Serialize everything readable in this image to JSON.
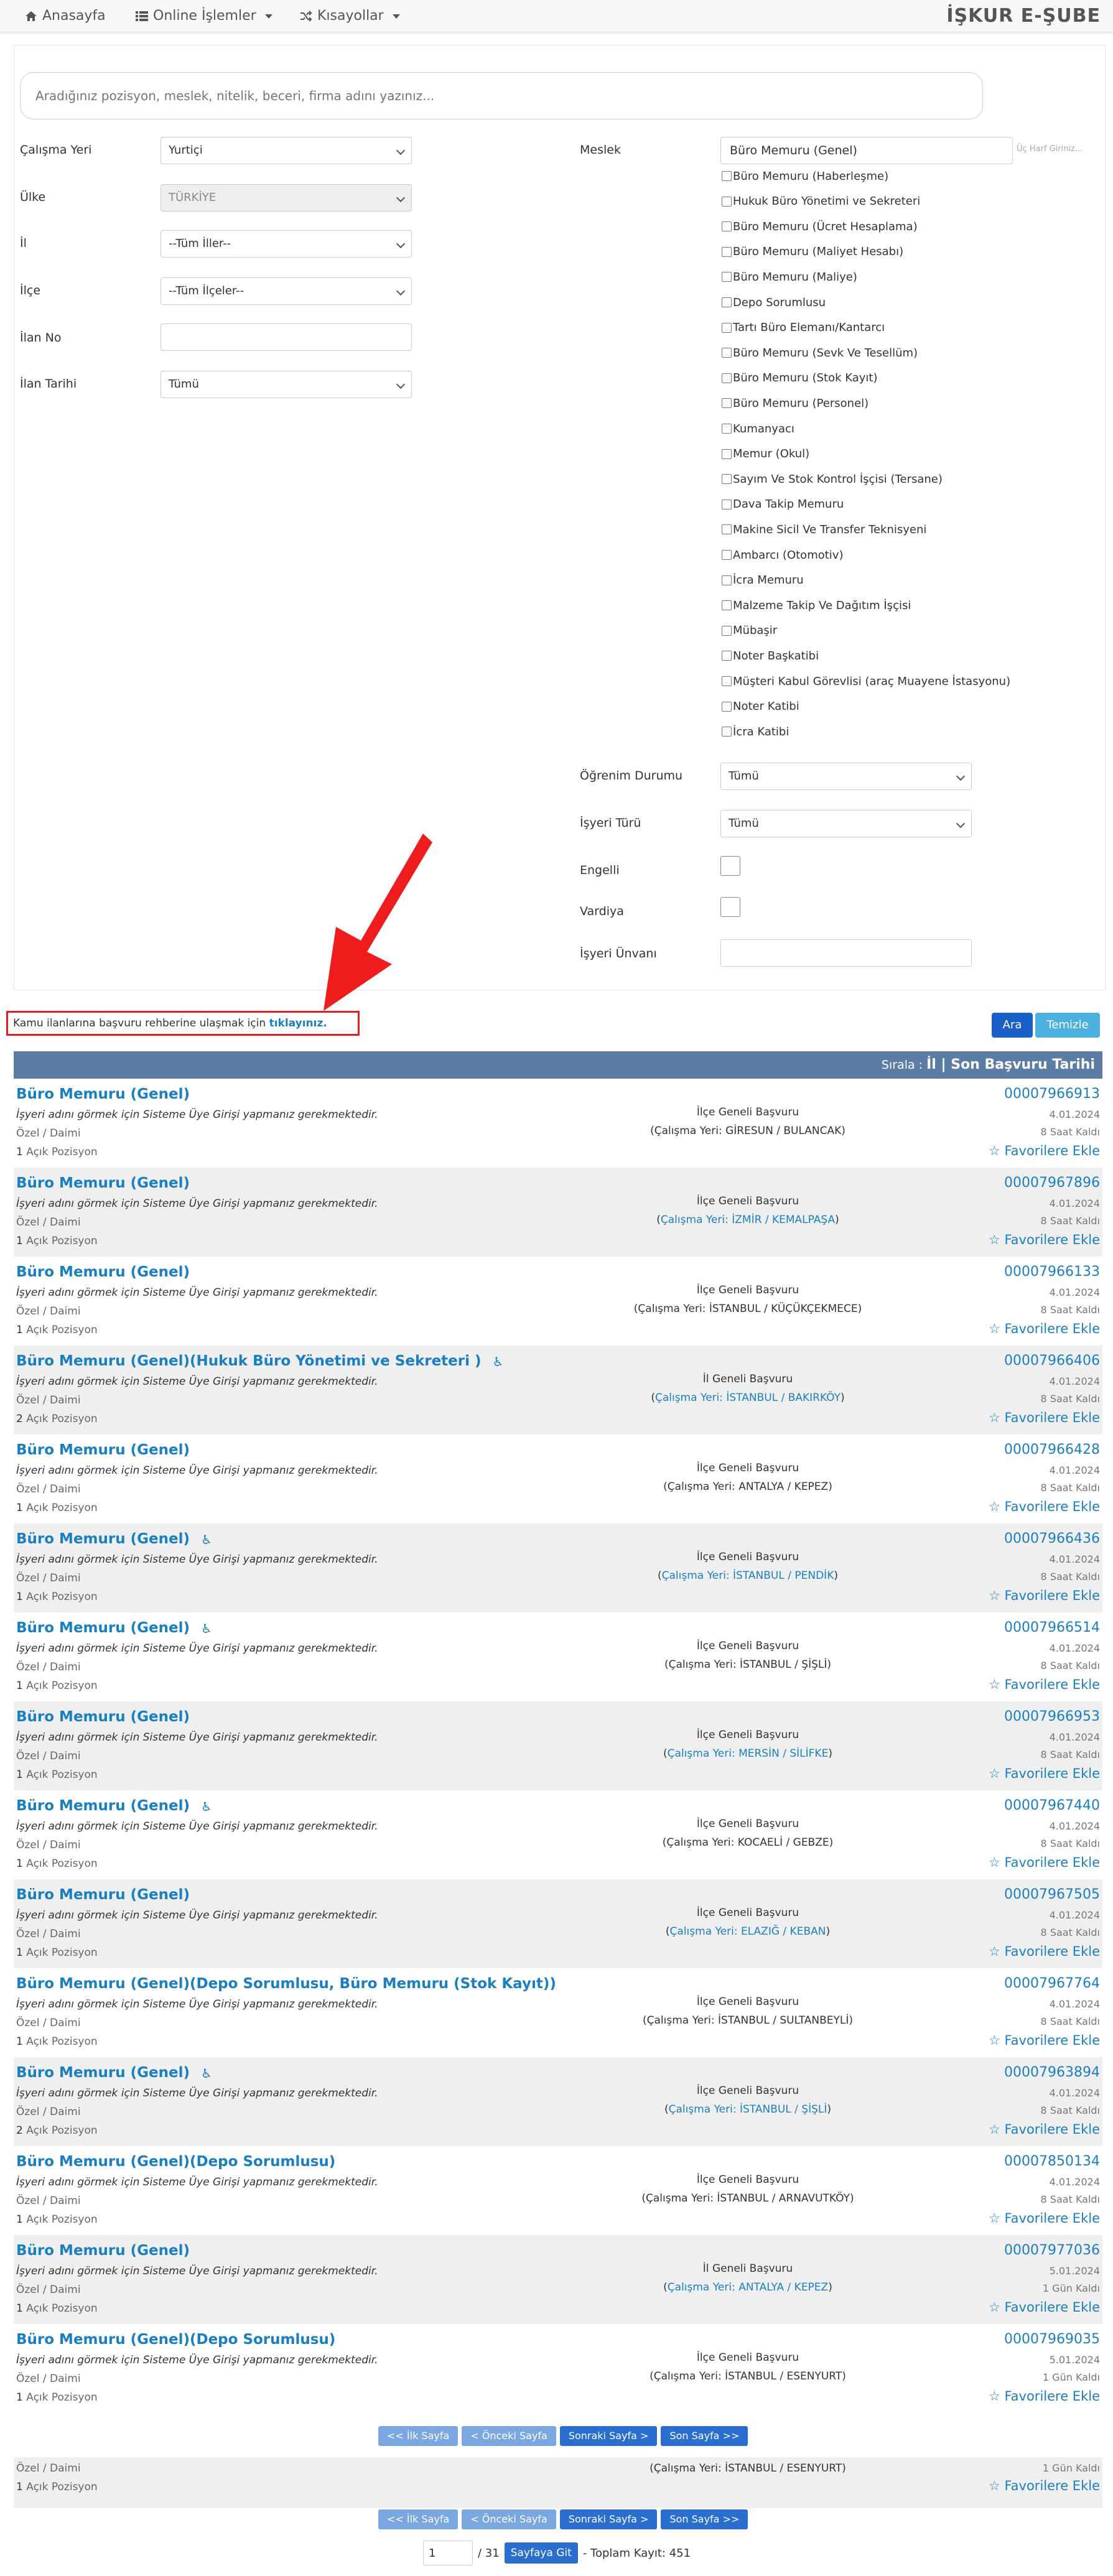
{
  "nav": {
    "home": "Anasayfa",
    "online": "Online İşlemler",
    "shortcuts": "Kısayollar",
    "brand": "İŞKUR E-ŞUBE"
  },
  "search": {
    "placeholder": "Aradığınız pozisyon, meslek, nitelik, beceri, firma adını yazınız..."
  },
  "filters": {
    "calisma_yeri_label": "Çalışma Yeri",
    "calisma_yeri_value": "Yurtiçi",
    "ulke_label": "Ülke",
    "ulke_value": "TÜRKİYE",
    "il_label": "İl",
    "il_value": "--Tüm İller--",
    "ilce_label": "İlçe",
    "ilce_value": "--Tüm İlçeler--",
    "ilan_no_label": "İlan No",
    "ilan_tarihi_label": "İlan Tarihi",
    "ilan_tarihi_value": "Tümü",
    "meslek_label": "Meslek",
    "meslek_value": "Büro Memuru (Genel)",
    "meslek_hint": "Üç Harf Giriniz...",
    "ogrenim_label": "Öğrenim Durumu",
    "ogrenim_value": "Tümü",
    "isyeri_turu_label": "İşyeri Türü",
    "isyeri_turu_value": "Tümü",
    "engelli_label": "Engelli",
    "vardiya_label": "Vardiya",
    "isyeri_unvani_label": "İşyeri Ünvanı"
  },
  "meslek_options": [
    "Büro Memuru (Haberleşme)",
    "Hukuk Büro Yönetimi ve Sekreteri",
    "Büro Memuru (Ücret Hesaplama)",
    "Büro Memuru (Maliyet Hesabı)",
    "Büro Memuru (Maliye)",
    "Depo Sorumlusu",
    "Tartı Büro Elemanı/Kantarcı",
    "Büro Memuru (Sevk Ve Tesellüm)",
    "Büro Memuru (Stok Kayıt)",
    "Büro Memuru (Personel)",
    "Kumanyacı",
    "Memur (Okul)",
    "Sayım Ve Stok Kontrol İşçisi (Tersane)",
    "Dava Takip Memuru",
    "Makine Sicil Ve Transfer Teknisyeni",
    "Ambarcı (Otomotiv)",
    "İcra Memuru",
    "Malzeme Takip Ve Dağıtım İşçisi",
    "Mübaşir",
    "Noter Başkatibi",
    "Müşteri Kabul Görevlisi (araç Muayene İstasyonu)",
    "Noter Katibi",
    "İcra Katibi"
  ],
  "announcement": {
    "text": "Kamu ilanlarına başvuru rehberine ulaşmak için ",
    "link": "tıklayınız."
  },
  "buttons": {
    "ara": "Ara",
    "temizle": "Temizle"
  },
  "sort": {
    "label": "Sırala : ",
    "il": "İl",
    "sep": " | ",
    "date": "Son Başvuru Tarihi"
  },
  "results": [
    {
      "title": "Büro Memuru (Genel)",
      "acc": false,
      "note": "İşyeri adını görmek için Sisteme Üye Girişi yapmanız gerekmektedir.",
      "type": "Özel / Daimi",
      "count": "1",
      "pos": "Açık Pozisyon",
      "app": "İlçe Geneli Başvuru",
      "loc_pre": "(",
      "loc_lbl": "Çalışma Yeri: ",
      "loc": "GİRESUN / BULANCAK",
      "loc_post": ")",
      "loc_blue": false,
      "no": "00007966913",
      "date": "4.01.2024",
      "left": "8 Saat Kaldı",
      "fav": "Favorilere Ekle"
    },
    {
      "title": "Büro Memuru (Genel)",
      "acc": false,
      "note": "İşyeri adını görmek için Sisteme Üye Girişi yapmanız gerekmektedir.",
      "type": "Özel / Daimi",
      "count": "1",
      "pos": "Açık Pozisyon",
      "app": "İlçe Geneli Başvuru",
      "loc_pre": "(",
      "loc_lbl": "Çalışma Yeri: ",
      "loc": "İZMİR / KEMALPAŞA",
      "loc_post": ")",
      "loc_blue": true,
      "no": "00007967896",
      "date": "4.01.2024",
      "left": "8 Saat Kaldı",
      "fav": "Favorilere Ekle"
    },
    {
      "title": "Büro Memuru (Genel)",
      "acc": false,
      "note": "İşyeri adını görmek için Sisteme Üye Girişi yapmanız gerekmektedir.",
      "type": "Özel / Daimi",
      "count": "1",
      "pos": "Açık Pozisyon",
      "app": "İlçe Geneli Başvuru",
      "loc_pre": "(",
      "loc_lbl": "Çalışma Yeri: ",
      "loc": "İSTANBUL / KÜÇÜKÇEKMECE",
      "loc_post": ")",
      "loc_blue": false,
      "no": "00007966133",
      "date": "4.01.2024",
      "left": "8 Saat Kaldı",
      "fav": "Favorilere Ekle"
    },
    {
      "title": "Büro Memuru (Genel)(Hukuk Büro Yönetimi ve Sekreteri )",
      "acc": true,
      "note": "İşyeri adını görmek için Sisteme Üye Girişi yapmanız gerekmektedir.",
      "type": "Özel / Daimi",
      "count": "2",
      "pos": "Açık Pozisyon",
      "app": "İl Geneli Başvuru",
      "loc_pre": "(",
      "loc_lbl": "Çalışma Yeri: ",
      "loc": "İSTANBUL / BAKIRKÖY",
      "loc_post": ")",
      "loc_blue": true,
      "no": "00007966406",
      "date": "4.01.2024",
      "left": "8 Saat Kaldı",
      "fav": "Favorilere Ekle"
    },
    {
      "title": "Büro Memuru (Genel)",
      "acc": false,
      "note": "İşyeri adını görmek için Sisteme Üye Girişi yapmanız gerekmektedir.",
      "type": "Özel / Daimi",
      "count": "1",
      "pos": "Açık Pozisyon",
      "app": "İlçe Geneli Başvuru",
      "loc_pre": "(",
      "loc_lbl": "Çalışma Yeri: ",
      "loc": "ANTALYA / KEPEZ",
      "loc_post": ")",
      "loc_blue": false,
      "no": "00007966428",
      "date": "4.01.2024",
      "left": "8 Saat Kaldı",
      "fav": "Favorilere Ekle"
    },
    {
      "title": "Büro Memuru (Genel)",
      "acc": true,
      "note": "İşyeri adını görmek için Sisteme Üye Girişi yapmanız gerekmektedir.",
      "type": "Özel / Daimi",
      "count": "1",
      "pos": "Açık Pozisyon",
      "app": "İlçe Geneli Başvuru",
      "loc_pre": "(",
      "loc_lbl": "Çalışma Yeri: ",
      "loc": "İSTANBUL / PENDİK",
      "loc_post": ")",
      "loc_blue": true,
      "no": "00007966436",
      "date": "4.01.2024",
      "left": "8 Saat Kaldı",
      "fav": "Favorilere Ekle"
    },
    {
      "title": "Büro Memuru (Genel)",
      "acc": true,
      "note": "İşyeri adını görmek için Sisteme Üye Girişi yapmanız gerekmektedir.",
      "type": "Özel / Daimi",
      "count": "1",
      "pos": "Açık Pozisyon",
      "app": "İlçe Geneli Başvuru",
      "loc_pre": "(",
      "loc_lbl": "Çalışma Yeri: ",
      "loc": "İSTANBUL / ŞİŞLİ",
      "loc_post": ")",
      "loc_blue": false,
      "no": "00007966514",
      "date": "4.01.2024",
      "left": "8 Saat Kaldı",
      "fav": "Favorilere Ekle"
    },
    {
      "title": "Büro Memuru (Genel)",
      "acc": false,
      "note": "İşyeri adını görmek için Sisteme Üye Girişi yapmanız gerekmektedir.",
      "type": "Özel / Daimi",
      "count": "1",
      "pos": "Açık Pozisyon",
      "app": "İlçe Geneli Başvuru",
      "loc_pre": "(",
      "loc_lbl": "Çalışma Yeri: ",
      "loc": "MERSİN / SİLİFKE",
      "loc_post": ")",
      "loc_blue": true,
      "no": "00007966953",
      "date": "4.01.2024",
      "left": "8 Saat Kaldı",
      "fav": "Favorilere Ekle"
    },
    {
      "title": "Büro Memuru (Genel)",
      "acc": true,
      "note": "İşyeri adını görmek için Sisteme Üye Girişi yapmanız gerekmektedir.",
      "type": "Özel / Daimi",
      "count": "1",
      "pos": "Açık Pozisyon",
      "app": "İlçe Geneli Başvuru",
      "loc_pre": "(",
      "loc_lbl": "Çalışma Yeri: ",
      "loc": "KOCAELİ / GEBZE",
      "loc_post": ")",
      "loc_blue": false,
      "no": "00007967440",
      "date": "4.01.2024",
      "left": "8 Saat Kaldı",
      "fav": "Favorilere Ekle"
    },
    {
      "title": "Büro Memuru (Genel)",
      "acc": false,
      "note": "İşyeri adını görmek için Sisteme Üye Girişi yapmanız gerekmektedir.",
      "type": "Özel / Daimi",
      "count": "1",
      "pos": "Açık Pozisyon",
      "app": "İlçe Geneli Başvuru",
      "loc_pre": "(",
      "loc_lbl": "Çalışma Yeri: ",
      "loc": "ELAZIĞ / KEBAN",
      "loc_post": ")",
      "loc_blue": true,
      "no": "00007967505",
      "date": "4.01.2024",
      "left": "8 Saat Kaldı",
      "fav": "Favorilere Ekle"
    },
    {
      "title": "Büro Memuru (Genel)(Depo Sorumlusu, Büro Memuru (Stok Kayıt))",
      "acc": false,
      "note": "İşyeri adını görmek için Sisteme Üye Girişi yapmanız gerekmektedir.",
      "type": "Özel / Daimi",
      "count": "1",
      "pos": "Açık Pozisyon",
      "app": "İlçe Geneli Başvuru",
      "loc_pre": "(",
      "loc_lbl": "Çalışma Yeri: ",
      "loc": "İSTANBUL / SULTANBEYLİ",
      "loc_post": ")",
      "loc_blue": false,
      "no": "00007967764",
      "date": "4.01.2024",
      "left": "8 Saat Kaldı",
      "fav": "Favorilere Ekle"
    },
    {
      "title": "Büro Memuru (Genel)",
      "acc": true,
      "note": "İşyeri adını görmek için Sisteme Üye Girişi yapmanız gerekmektedir.",
      "type": "Özel / Daimi",
      "count": "2",
      "pos": "Açık Pozisyon",
      "app": "İlçe Geneli Başvuru",
      "loc_pre": "(",
      "loc_lbl": "Çalışma Yeri: ",
      "loc": "İSTANBUL / ŞİŞLİ",
      "loc_post": ")",
      "loc_blue": true,
      "no": "00007963894",
      "date": "4.01.2024",
      "left": "8 Saat Kaldı",
      "fav": "Favorilere Ekle"
    },
    {
      "title": "Büro Memuru (Genel)(Depo Sorumlusu)",
      "acc": false,
      "note": "İşyeri adını görmek için Sisteme Üye Girişi yapmanız gerekmektedir.",
      "type": "Özel / Daimi",
      "count": "1",
      "pos": "Açık Pozisyon",
      "app": "İlçe Geneli Başvuru",
      "loc_pre": "(",
      "loc_lbl": "Çalışma Yeri: ",
      "loc": "İSTANBUL / ARNAVUTKÖY",
      "loc_post": ")",
      "loc_blue": false,
      "no": "00007850134",
      "date": "4.01.2024",
      "left": "8 Saat Kaldı",
      "fav": "Favorilere Ekle"
    },
    {
      "title": "Büro Memuru (Genel)",
      "acc": false,
      "note": "İşyeri adını görmek için Sisteme Üye Girişi yapmanız gerekmektedir.",
      "type": "Özel / Daimi",
      "count": "1",
      "pos": "Açık Pozisyon",
      "app": "İl Geneli Başvuru",
      "loc_pre": "(",
      "loc_lbl": "Çalışma Yeri: ",
      "loc": "ANTALYA / KEPEZ",
      "loc_post": ")",
      "loc_blue": true,
      "no": "00007977036",
      "date": "5.01.2024",
      "left": "1 Gün Kaldı",
      "fav": "Favorilere Ekle"
    },
    {
      "title": "Büro Memuru (Genel)(Depo Sorumlusu)",
      "acc": false,
      "note": "İşyeri adını görmek için Sisteme Üye Girişi yapmanız gerekmektedir.",
      "type": "Özel / Daimi",
      "count": "1",
      "pos": "Açık Pozisyon",
      "app": "İlçe Geneli Başvuru",
      "loc_pre": "(",
      "loc_lbl": "Çalışma Yeri: ",
      "loc": "İSTANBUL / ESENYURT",
      "loc_post": ")",
      "loc_blue": false,
      "no": "00007969035",
      "date": "5.01.2024",
      "left": "1 Gün Kaldı",
      "fav": "Favorilere Ekle"
    }
  ],
  "pager": {
    "first": "<< İlk Sayfa",
    "prev": "< Önceki Sayfa",
    "next": "Sonraki Sayfa >",
    "last": "Son Sayfa >>"
  },
  "partial": {
    "type": "Özel / Daimi",
    "count": "1",
    "pos": "Açık Pozisyon",
    "loc": "(Çalışma Yeri: İSTANBUL / ESENYURT)",
    "left": "1 Gün Kaldı",
    "fav": "Favorilere Ekle"
  },
  "goto": {
    "page": "1",
    "total": "/ 31",
    "button": "Sayfaya Git",
    "records": "- Toplam Kayıt: 451"
  },
  "colors": {
    "link": "#1a7fc1",
    "sort_bar": "#5c7da6",
    "alert": "#e02020"
  }
}
